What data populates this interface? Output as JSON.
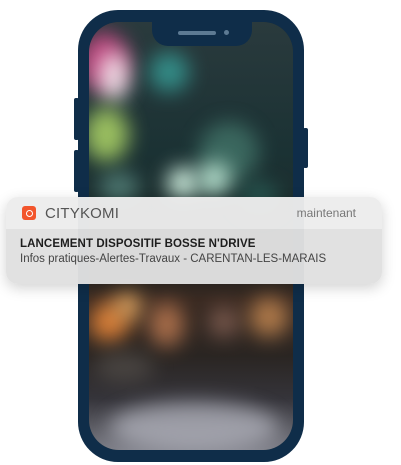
{
  "notification": {
    "app_name": "CITYKOMI",
    "app_icon": "citykomi-app-icon",
    "timestamp": "maintenant",
    "title": "LANCEMENT DISPOSITIF BOSSE N'DRIVE",
    "body": "Infos pratiques-Alertes-Travaux - CARENTAN-LES-MARAIS"
  },
  "colors": {
    "phone_frame": "#0f2d49",
    "app_icon": "#f2552c",
    "notification_header": "#ececec",
    "notification_body": "#e0e0e0"
  }
}
